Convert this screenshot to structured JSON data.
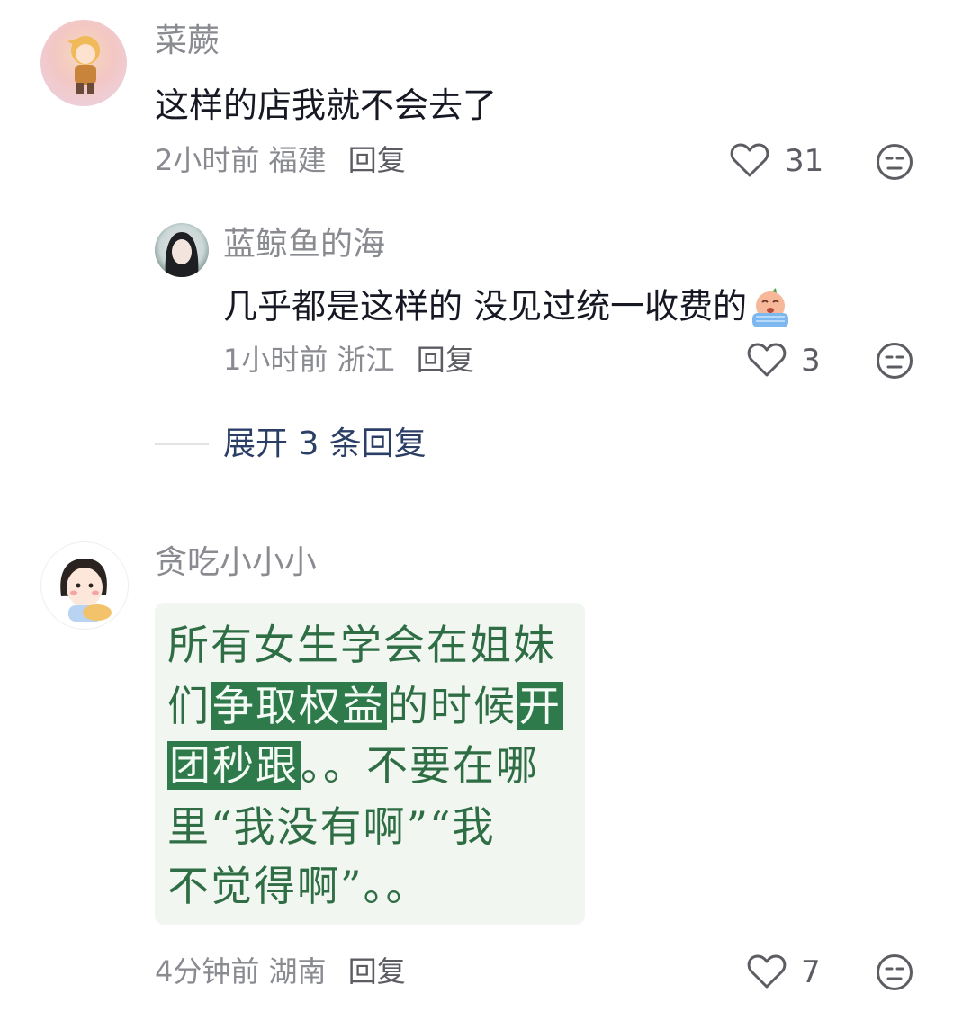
{
  "comments": [
    {
      "username": "菜蕨",
      "text": "这样的店我就不会去了",
      "time": "2小时前",
      "location": "福建",
      "reply_label": "回复",
      "likes": "31"
    },
    {
      "username": "蓝鲸鱼的海",
      "text": "几乎都是这样的 没见过统一收费的",
      "time": "1小时前",
      "location": "浙江",
      "reply_label": "回复",
      "likes": "3"
    },
    {
      "username": "贪吃小小小",
      "time": "4分钟前",
      "location": "湖南",
      "reply_label": "回复",
      "likes": "7"
    }
  ],
  "expand_replies": "展开 3 条回复",
  "image_text": {
    "line1": "所有女生学会在姐妹",
    "line2_a": "们",
    "line2_hl1": "争取权益",
    "line2_b": "的时候",
    "line2_hl2": "开",
    "line3_hl": "团秒跟",
    "line3_b": "。。不要在哪",
    "line4": "里“我没有啊”“我",
    "line5": "不觉得啊”。。"
  },
  "colors": {
    "text_primary": "#161823",
    "text_secondary": "#8a8b91",
    "link": "#2b3e66",
    "image_green": "#2f7a4b"
  },
  "icons": [
    "heart-icon",
    "dislike-face-icon",
    "crying-emoji-icon"
  ]
}
